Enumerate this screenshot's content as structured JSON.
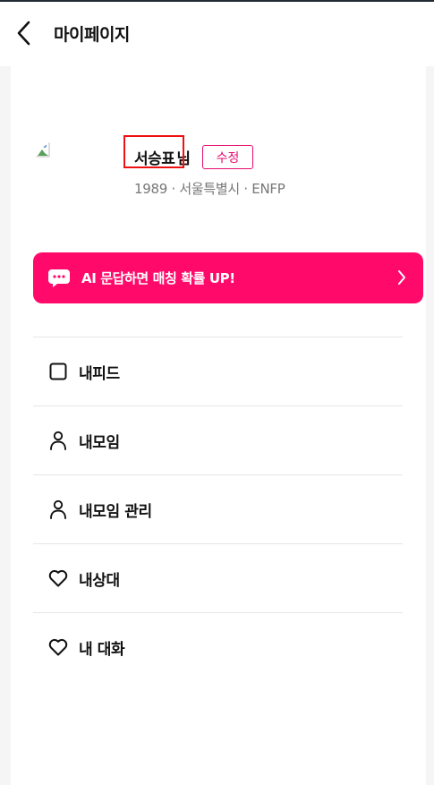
{
  "header": {
    "back_icon": "chevron-left-icon",
    "title": "마이페이지"
  },
  "profile": {
    "avatar": "broken-image-icon",
    "name": "서승표",
    "honorific": "님",
    "edit_label": "수정",
    "meta": "1989 · 서울특별시 · ENFP",
    "highlight_color": "#ee1111"
  },
  "ai_banner": {
    "icon": "chat-bubble-icon",
    "label": "AI 문답하면 매칭 확률 UP!",
    "arrow_icon": "chevron-right-icon",
    "color": "#ff0a6b"
  },
  "menu": {
    "items": [
      {
        "icon": "square-icon",
        "label": "내피드"
      },
      {
        "icon": "person-icon",
        "label": "내모임"
      },
      {
        "icon": "person-icon",
        "label": "내모임 관리"
      },
      {
        "icon": "heart-icon",
        "label": "내상대"
      },
      {
        "icon": "heart-icon",
        "label": "내 대화"
      }
    ]
  },
  "colors": {
    "accent": "#e60b6e",
    "background": "#f5f5f6"
  }
}
